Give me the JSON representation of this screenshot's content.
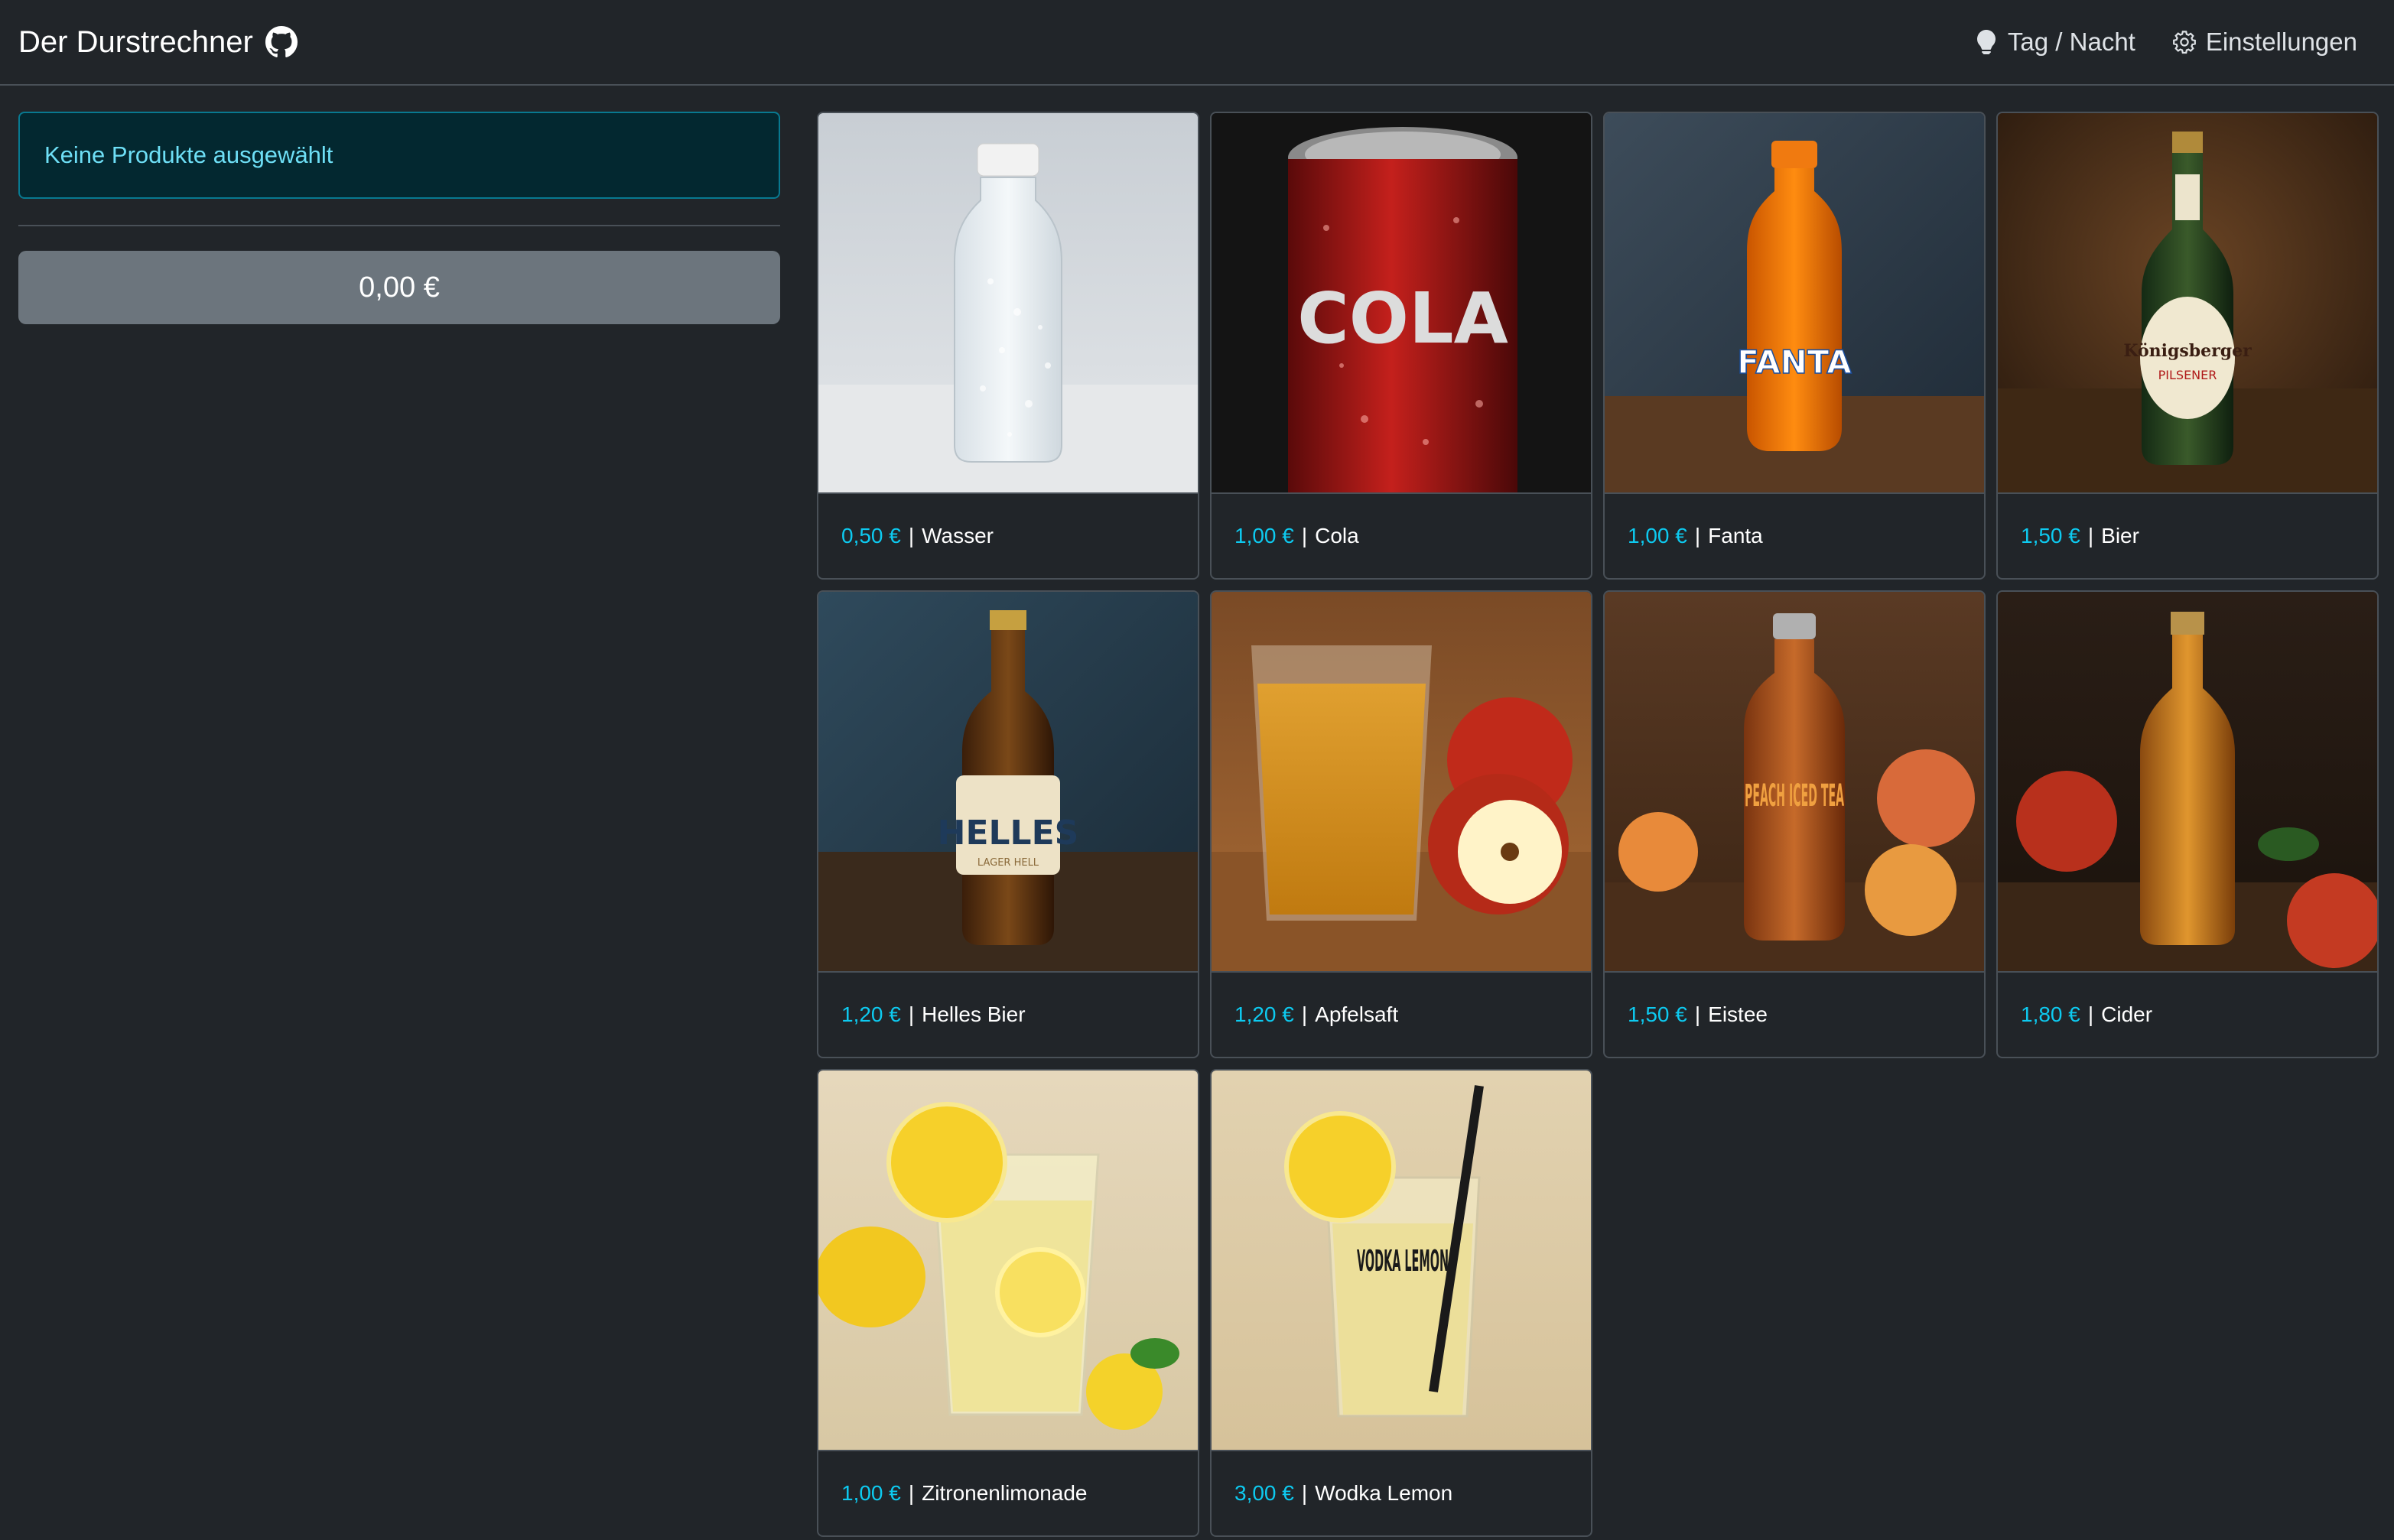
{
  "navbar": {
    "brand": "Der Durstrechner",
    "theme_toggle": "Tag / Nacht",
    "settings": "Einstellungen"
  },
  "sidebar": {
    "alert": "Keine Produkte ausgewählt",
    "total": "0,00 €"
  },
  "colors": {
    "background": "#212529",
    "accent_price": "#0dcaf0",
    "alert_bg": "#032830",
    "alert_text": "#6edff6",
    "total_button": "#6c757d"
  },
  "icons": [
    "github-icon",
    "lightbulb-icon",
    "gear-icon"
  ],
  "products": [
    {
      "price": "0,50 €",
      "name": "Wasser"
    },
    {
      "price": "1,00 €",
      "name": "Cola",
      "label": "COLA"
    },
    {
      "price": "1,00 €",
      "name": "Fanta",
      "label": "FANTA"
    },
    {
      "price": "1,50 €",
      "name": "Bier",
      "label": "Königsberger",
      "sublabel": "PILSENER"
    },
    {
      "price": "1,20 €",
      "name": "Helles Bier",
      "label": "HELLES",
      "sublabel": "LAGER HELL"
    },
    {
      "price": "1,20 €",
      "name": "Apfelsaft"
    },
    {
      "price": "1,50 €",
      "name": "Eistee",
      "label": "PEACH ICED TEA"
    },
    {
      "price": "1,80 €",
      "name": "Cider"
    },
    {
      "price": "1,00 €",
      "name": "Zitronenlimonade"
    },
    {
      "price": "3,00 €",
      "name": "Wodka Lemon",
      "label": "VODKA LEMON"
    }
  ]
}
